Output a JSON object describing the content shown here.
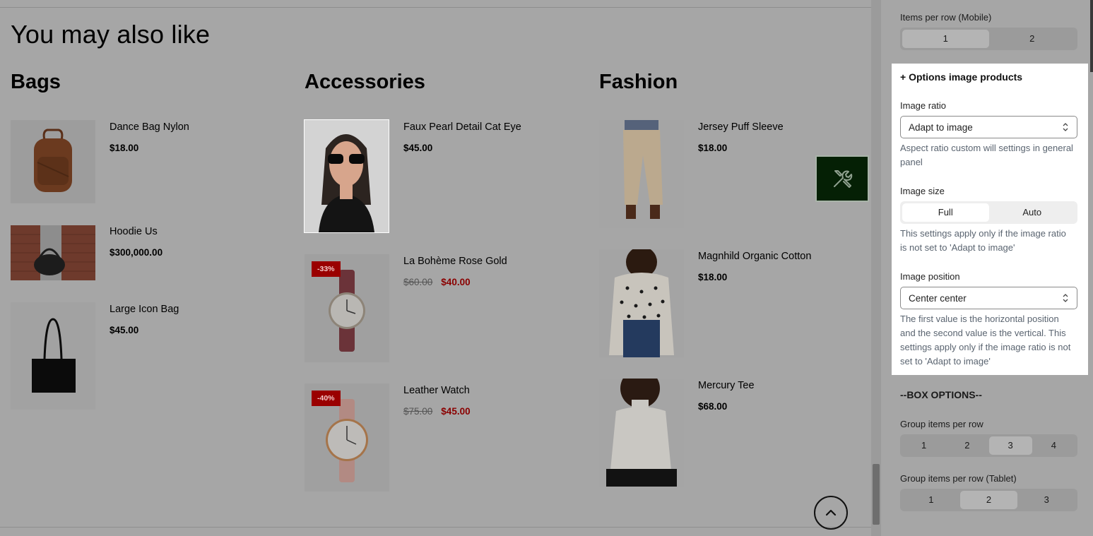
{
  "main": {
    "title": "You may also like",
    "columns": [
      {
        "title": "Bags",
        "products": [
          {
            "name": "Dance Bag Nylon",
            "price": "$18.00",
            "old_price": "",
            "badge": "",
            "image": "brown-backpack"
          },
          {
            "name": "Hoodie Us",
            "price": "$300,000.00",
            "old_price": "",
            "badge": "",
            "image": "black-shoulder-bag"
          },
          {
            "name": "Large Icon Bag",
            "price": "$45.00",
            "old_price": "",
            "badge": "",
            "image": "black-tote-bag"
          }
        ]
      },
      {
        "title": "Accessories",
        "products": [
          {
            "name": "Faux Pearl Detail Cat Eye",
            "price": "$45.00",
            "old_price": "",
            "badge": "",
            "image": "woman-sunglasses"
          },
          {
            "name": "La Bohème Rose Gold",
            "price": "$40.00",
            "old_price": "$60.00",
            "badge": "-33%",
            "image": "burgundy-watch"
          },
          {
            "name": "Leather Watch",
            "price": "$45.00",
            "old_price": "$75.00",
            "badge": "-40%",
            "image": "pink-watch"
          }
        ]
      },
      {
        "title": "Fashion",
        "products": [
          {
            "name": "Jersey Puff Sleeve",
            "price": "$18.00",
            "old_price": "",
            "badge": "",
            "image": "beige-trousers"
          },
          {
            "name": "Magnhild Organic Cotton",
            "price": "$18.00",
            "old_price": "",
            "badge": "",
            "image": "heart-sweater"
          },
          {
            "name": "Mercury Tee",
            "price": "$68.00",
            "old_price": "",
            "badge": "",
            "image": "white-turtleneck"
          }
        ]
      }
    ]
  },
  "floating": {
    "tools_icon": "tools-icon",
    "scroll_top_icon": "chevron-up-icon"
  },
  "panel": {
    "items_per_row_mobile": {
      "label": "Items per row (Mobile)",
      "options": [
        "1",
        "2"
      ],
      "selected": "1"
    },
    "options_image": {
      "title": "+ Options image products",
      "image_ratio_label": "Image ratio",
      "image_ratio_value": "Adapt to image",
      "image_ratio_help": "Aspect ratio custom will settings in general panel",
      "image_size_label": "Image size",
      "image_size_options": [
        "Full",
        "Auto"
      ],
      "image_size_selected": "Full",
      "image_size_help": "This settings apply only if the image ratio is not set to 'Adapt to image'",
      "image_position_label": "Image position",
      "image_position_value": "Center center",
      "image_position_help": "The first value is the horizontal position and the second value is the vertical. This settings apply only if the image ratio is not set to 'Adapt to image'"
    },
    "box_options_title": "--BOX OPTIONS--",
    "group_items_per_row": {
      "label": "Group items per row",
      "options": [
        "1",
        "2",
        "3",
        "4"
      ],
      "selected": "3"
    },
    "group_items_per_row_tablet": {
      "label": "Group items per row (Tablet)",
      "options": [
        "1",
        "2",
        "3"
      ],
      "selected": "2"
    }
  }
}
